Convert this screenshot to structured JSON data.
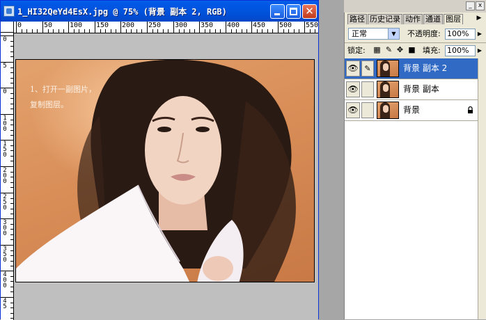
{
  "document": {
    "title": "1_HI32QeYd4EsX.jpg @ 75% (背景 副本 2, RGB)",
    "caption_line1": "1、打开一副图片，",
    "caption_line2": "复制图层。",
    "ruler_h_labels": [
      "0",
      "50",
      "100",
      "150",
      "200",
      "250",
      "300",
      "350",
      "400",
      "450",
      "500",
      "550"
    ],
    "ruler_v_labels": [
      "0",
      "5",
      "0",
      "1 0 0",
      "1 5 0",
      "2 0 0",
      "2 5 0",
      "3 0 0",
      "3 5 0",
      "4 0 0",
      "4 5"
    ]
  },
  "titlebar_icons": {
    "minimize": "minimize-icon",
    "maximize": "maximize-icon",
    "close": "close-icon"
  },
  "layers_panel": {
    "tabs": [
      {
        "label": "路径",
        "active": false
      },
      {
        "label": "历史记录",
        "active": false
      },
      {
        "label": "动作",
        "active": false
      },
      {
        "label": "通道",
        "active": false
      },
      {
        "label": "图层",
        "active": true
      }
    ],
    "blend_mode": "正常",
    "opacity_label": "不透明度:",
    "opacity_value": "100%",
    "lock_label": "锁定:",
    "fill_label": "填充:",
    "fill_value": "100%",
    "lock_icons": [
      "lock-transparent-icon",
      "lock-brush-icon",
      "lock-move-icon",
      "lock-all-icon"
    ],
    "layers": [
      {
        "name": "背景 副本 2",
        "selected": true,
        "visible": true,
        "locked": false
      },
      {
        "name": "背景 副本",
        "selected": false,
        "visible": true,
        "locked": false
      },
      {
        "name": "背景",
        "selected": false,
        "visible": true,
        "locked": true
      }
    ]
  },
  "colors": {
    "titlebar_blue": "#0054e3",
    "selected_layer": "#316ac5",
    "panel_bg": "#ece9d8",
    "canvas_bg": "#bfbfbf"
  }
}
